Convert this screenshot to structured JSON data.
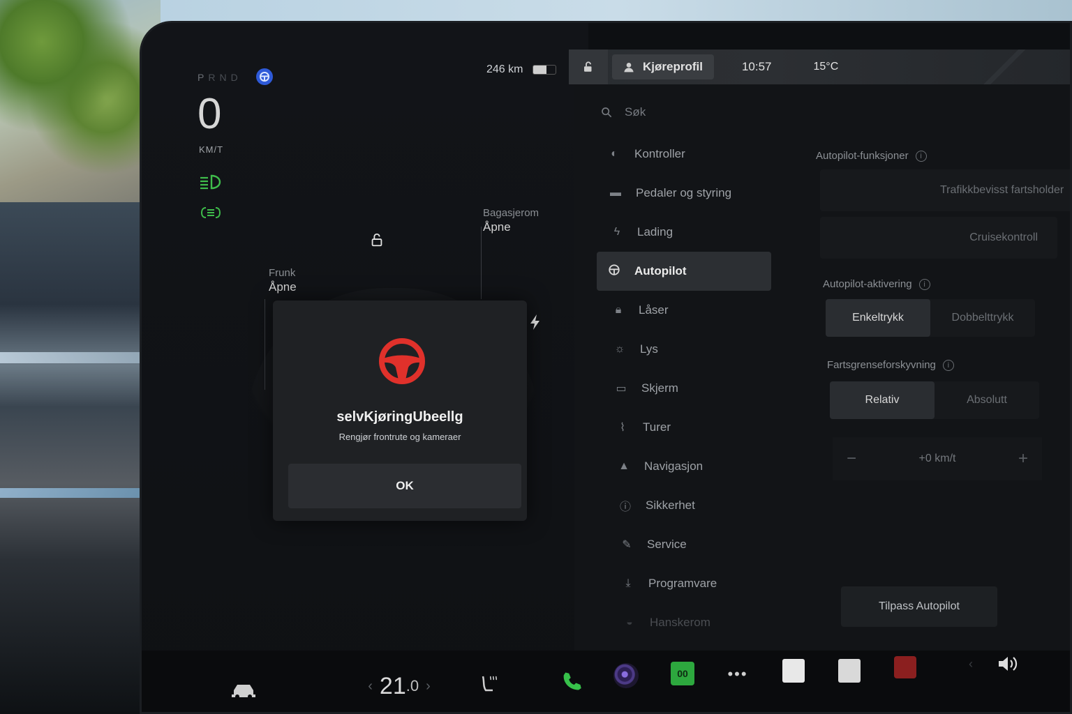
{
  "drive": {
    "gears": [
      "P",
      "R",
      "N",
      "D"
    ],
    "speed": "0",
    "speed_unit": "KM/T",
    "range": "246 km",
    "battery_level": 0.6
  },
  "topbar": {
    "profile_label": "Kjøreprofil",
    "time": "10:57",
    "temperature": "15°C"
  },
  "car_view": {
    "trunk_label": "Bagasjerom",
    "trunk_action": "Åpne",
    "frunk_label": "Frunk",
    "frunk_action": "Åpne"
  },
  "alert": {
    "title": "selvKjøringUbeellg",
    "message": "Rengjør frontrute og kameraer",
    "ok_label": "OK",
    "icon": "steering-wheel-icon",
    "icon_color": "#e0312b"
  },
  "settings": {
    "search_placeholder": "Søk",
    "menu": [
      {
        "label": "Kontroller",
        "icon": "toggle-icon"
      },
      {
        "label": "Pedaler og styring",
        "icon": "car-icon"
      },
      {
        "label": "Lading",
        "icon": "bolt-icon"
      },
      {
        "label": "Autopilot",
        "icon": "steering-wheel-icon",
        "active": true
      },
      {
        "label": "Låser",
        "icon": "lock-icon"
      },
      {
        "label": "Lys",
        "icon": "sun-icon"
      },
      {
        "label": "Skjerm",
        "icon": "display-icon"
      },
      {
        "label": "Turer",
        "icon": "trips-icon"
      },
      {
        "label": "Navigasjon",
        "icon": "navigation-icon"
      },
      {
        "label": "Sikkerhet",
        "icon": "info-icon"
      },
      {
        "label": "Service",
        "icon": "wrench-icon"
      },
      {
        "label": "Programvare",
        "icon": "download-icon"
      },
      {
        "label": "Hanskerom",
        "icon": "glovebox-icon"
      }
    ]
  },
  "autopilot": {
    "features_label": "Autopilot-funksjoner",
    "feature_tacc": "Trafikkbevisst fartsholder",
    "feature_cruise": "Cruisekontroll",
    "activation_label": "Autopilot-aktivering",
    "activation_single": "Enkeltrykk",
    "activation_double": "Dobbelttrykk",
    "offset_label": "Fartsgrenseforskyvning",
    "offset_relative": "Relativ",
    "offset_absolute": "Absolutt",
    "offset_value": "+0 km/t",
    "customize_label": "Tilpass Autopilot"
  },
  "bottom": {
    "cabin_temp": "21",
    "cabin_temp_decimal": ".0",
    "arcade_label": "00"
  },
  "colors": {
    "accent_green": "#3fbd4b",
    "autopilot_blue": "#2e5ad8",
    "alert_red": "#e0312b"
  }
}
